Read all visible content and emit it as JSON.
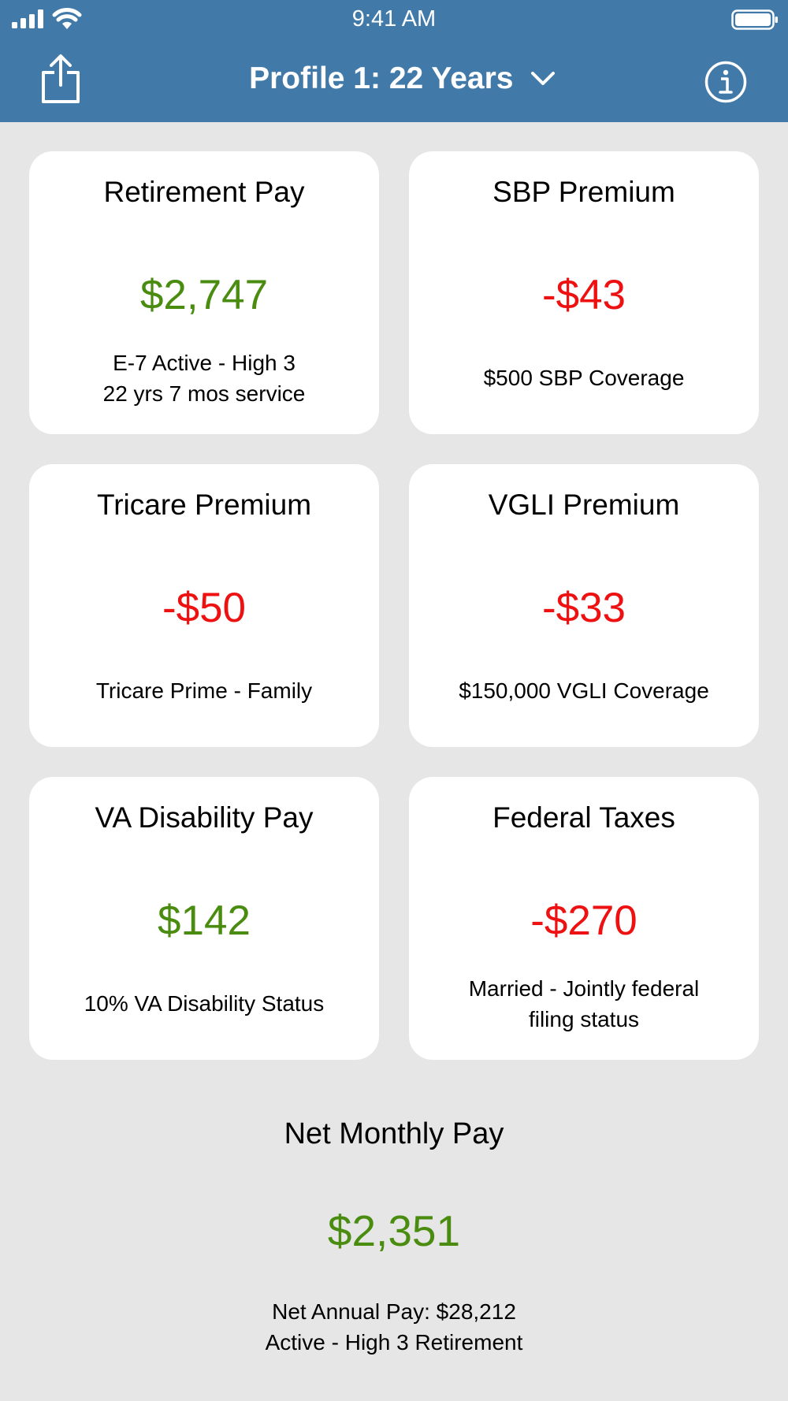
{
  "status_bar": {
    "time": "9:41 AM"
  },
  "nav": {
    "title": "Profile 1: 22 Years",
    "left_icon": "share-icon",
    "title_icon": "chevron-down-icon",
    "right_icon": "info-icon",
    "background_color": "#4179a8"
  },
  "cards": [
    {
      "title": "Retirement Pay",
      "value": "$2,747",
      "value_color": "#4a8c10",
      "description": [
        "E-7 Active - High 3",
        "22 yrs 7 mos service"
      ]
    },
    {
      "title": "SBP Premium",
      "value": "-$43",
      "value_color": "#ee1111",
      "description": [
        "$500 SBP Coverage"
      ]
    },
    {
      "title": "Tricare Premium",
      "value": "-$50",
      "value_color": "#ee1111",
      "description": [
        "Tricare Prime - Family"
      ]
    },
    {
      "title": "VGLI Premium",
      "value": "-$33",
      "value_color": "#ee1111",
      "description": [
        "$150,000 VGLI Coverage"
      ]
    },
    {
      "title": "VA Disability Pay",
      "value": "$142",
      "value_color": "#4a8c10",
      "description": [
        "10% VA Disability Status"
      ]
    },
    {
      "title": "Federal Taxes",
      "value": "-$270",
      "value_color": "#ee1111",
      "description": [
        "Married - Jointly federal",
        "filing status"
      ]
    }
  ],
  "net": {
    "title": "Net Monthly Pay",
    "value": "$2,351",
    "value_color": "#4a8c10",
    "annual": "Net Annual Pay: $28,212",
    "retirement_type": "Active - High 3 Retirement"
  }
}
